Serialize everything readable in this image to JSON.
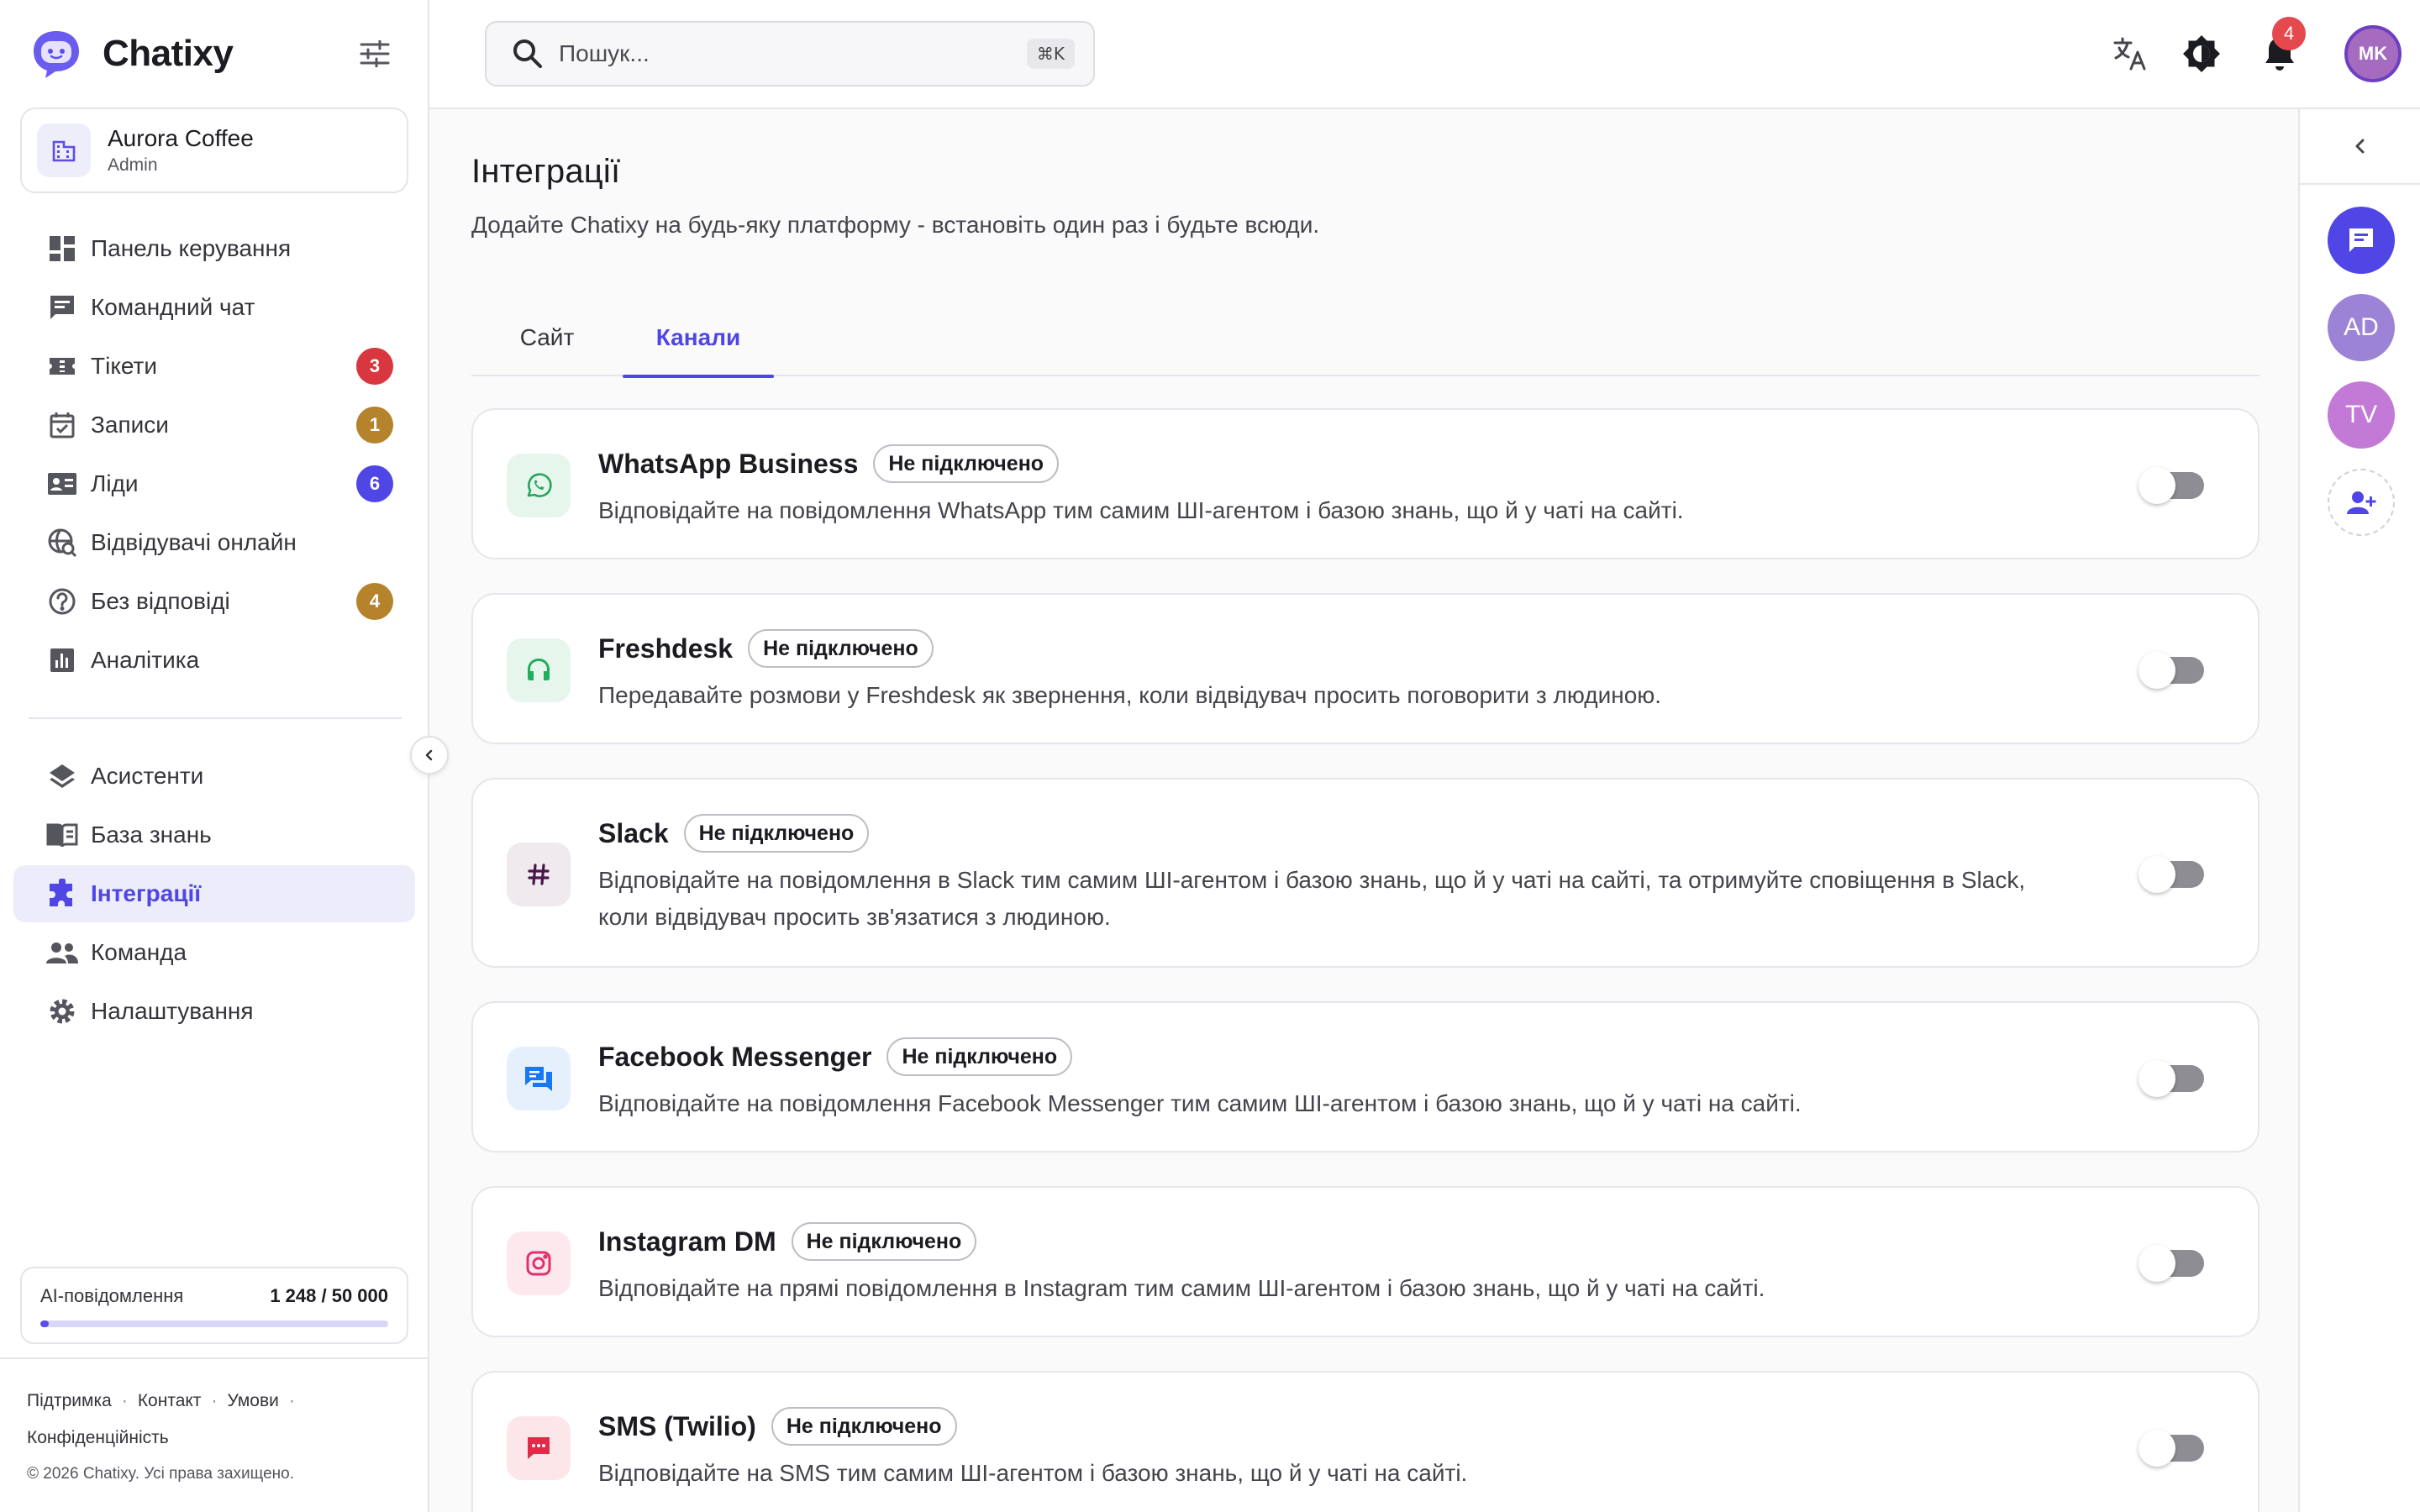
{
  "app": {
    "name": "Chatixy"
  },
  "org": {
    "name": "Aurora Coffee",
    "role": "Admin"
  },
  "nav": {
    "primary": [
      {
        "label": "Панель керування",
        "icon": "dashboard-icon"
      },
      {
        "label": "Командний чат",
        "icon": "chat-icon"
      },
      {
        "label": "Тікети",
        "icon": "ticket-icon",
        "badge": "3",
        "badge_color": "#d9373f"
      },
      {
        "label": "Записи",
        "icon": "calendar-icon",
        "badge": "1",
        "badge_color": "#b5832c"
      },
      {
        "label": "Ліди",
        "icon": "contact-card-icon",
        "badge": "6",
        "badge_color": "#4f46e5"
      },
      {
        "label": "Відвідувачі онлайн",
        "icon": "visitors-search-icon"
      },
      {
        "label": "Без відповіді",
        "icon": "help-circle-icon",
        "badge": "4",
        "badge_color": "#b5832c"
      },
      {
        "label": "Аналітика",
        "icon": "analytics-icon"
      }
    ],
    "secondary": [
      {
        "label": "Асистенти",
        "icon": "layers-icon"
      },
      {
        "label": "База знань",
        "icon": "book-icon"
      },
      {
        "label": "Інтеграції",
        "icon": "puzzle-icon",
        "active": true
      },
      {
        "label": "Команда",
        "icon": "people-icon"
      },
      {
        "label": "Налаштування",
        "icon": "gear-icon"
      }
    ]
  },
  "usage": {
    "label": "AI-повідомлення",
    "value": "1 248 / 50 000",
    "fraction": 0.025
  },
  "footer": {
    "links": [
      "Підтримка",
      "Контакт",
      "Умови",
      "Конфіденційність"
    ],
    "copyright": "© 2026 Chatixy. Усі права захищено."
  },
  "search": {
    "placeholder": "Пошук...",
    "shortcut": "⌘K"
  },
  "topbar": {
    "notifications_count": "4",
    "avatar_initials": "MK"
  },
  "page": {
    "title": "Інтеграції",
    "subtitle": "Додайте Chatixy на будь-яку платформу - встановіть один раз і будьте всюди.",
    "tabs": [
      {
        "label": "Сайт"
      },
      {
        "label": "Канали",
        "active": true
      }
    ]
  },
  "integrations": [
    {
      "name": "WhatsApp Business",
      "status": "Не підключено",
      "enabled": false,
      "icon": "whatsapp-icon",
      "color": "#25a55f",
      "bg": "#e7f6ec",
      "description": "Відповідайте на повідомлення WhatsApp тим самим ШІ-агентом і базою знань, що й у чаті на сайті."
    },
    {
      "name": "Freshdesk",
      "status": "Не підключено",
      "enabled": false,
      "icon": "headset-icon",
      "color": "#1fae5b",
      "bg": "#e6f6ec",
      "description": "Передавайте розмови у Freshdesk як звернення, коли відвідувач просить поговорити з людиною."
    },
    {
      "name": "Slack",
      "status": "Не підключено",
      "enabled": false,
      "icon": "hash-icon",
      "color": "#4a154b",
      "bg": "#eeeaee",
      "description": "Відповідайте на повідомлення в Slack тим самим ШІ-агентом і базою знань, що й у чаті на сайті, та отримуйте сповіщення в Slack, коли відвідувач просить зв'язатися з людиною."
    },
    {
      "name": "Facebook Messenger",
      "status": "Не підключено",
      "enabled": false,
      "icon": "messenger-icon",
      "color": "#1877f2",
      "bg": "#e6f0fd",
      "description": "Відповідайте на повідомлення Facebook Messenger тим самим ШІ-агентом і базою знань, що й у чаті на сайті."
    },
    {
      "name": "Instagram DM",
      "status": "Не підключено",
      "enabled": false,
      "icon": "instagram-icon",
      "color": "#e1306c",
      "bg": "#fde8ee",
      "description": "Відповідайте на прямі повідомлення в Instagram тим самим ШІ-агентом і базою знань, що й у чаті на сайті."
    },
    {
      "name": "SMS (Twilio)",
      "status": "Не підключено",
      "enabled": false,
      "icon": "sms-icon",
      "color": "#e22c47",
      "bg": "#fde6ea",
      "description": "Відповідайте на SMS тим самим ШІ-агентом і базою знань, що й у чаті на сайті."
    }
  ],
  "rail": {
    "chat_color": "#4f46e5",
    "avatars": [
      {
        "initials": "AD",
        "color": "#9c83d6"
      },
      {
        "initials": "TV",
        "color": "#c27ad6"
      }
    ]
  }
}
